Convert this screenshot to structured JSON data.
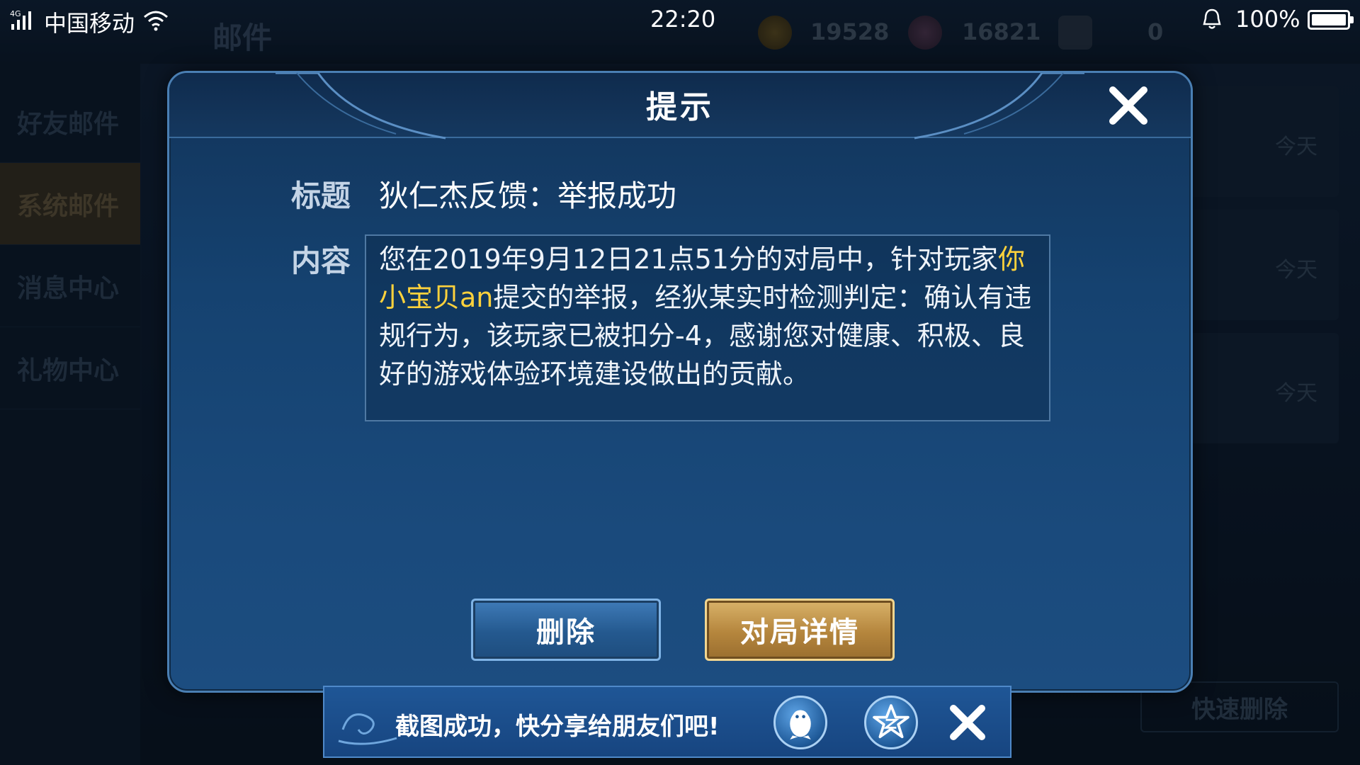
{
  "status_bar": {
    "network": "4G",
    "carrier": "中国移动",
    "time": "22:20",
    "battery_percent": "100%"
  },
  "background": {
    "screen_title": "邮件",
    "gold": "19528",
    "gems": "16821",
    "tokens": "0",
    "sidebar_items": [
      {
        "label": "好友邮件",
        "active": false
      },
      {
        "label": "系统邮件",
        "active": true
      },
      {
        "label": "消息中心",
        "active": false
      },
      {
        "label": "礼物中心",
        "active": false
      }
    ],
    "mail_dates": [
      "今天",
      "今天",
      "今天"
    ],
    "quick_delete_label": "快速删除"
  },
  "dialog": {
    "title": "提示",
    "subject_label": "标题",
    "subject_value": "狄仁杰反馈：举报成功",
    "content_label": "内容",
    "content_before": "您在2019年9月12日21点51分的对局中，针对玩家",
    "content_player": "你小宝贝an",
    "content_after": "提交的举报，经狄某实时检测判定：确认有违规行为，该玩家已被扣分-4，感谢您对健康、积极、良好的游戏体验环境建设做出的贡献。",
    "delete_button": "删除",
    "details_button": "对局详情"
  },
  "toast": {
    "message": "截图成功，快分享给朋友们吧!",
    "icons": [
      "qq-icon",
      "qzone-star-icon",
      "close-icon"
    ]
  },
  "colors": {
    "highlight": "#ffd23c",
    "dialog_bg": "#154270",
    "gold_button": "#b5863d",
    "blue_button": "#24598f"
  }
}
